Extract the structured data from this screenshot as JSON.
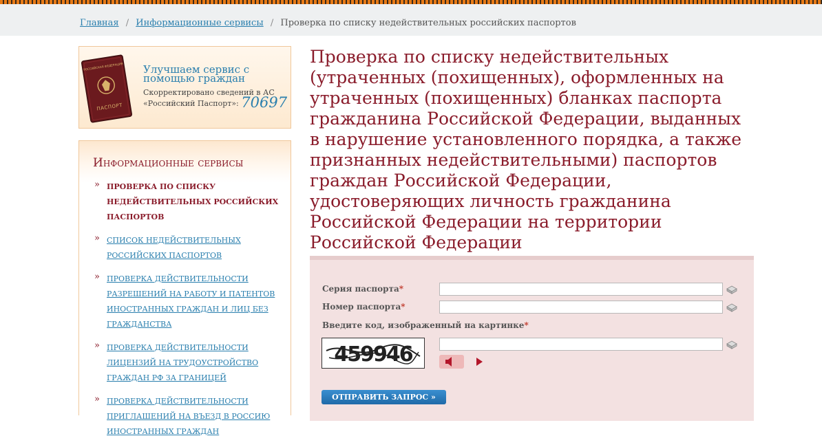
{
  "breadcrumb": {
    "home": "Главная",
    "services": "Информационные сервисы",
    "current": "Проверка по списку недействительных российских паспортов",
    "separator": "/"
  },
  "promo": {
    "passport_cover_top": "РОССИЙСКАЯ ФЕДЕРАЦИЯ",
    "passport_cover_bottom": "ПАСПОРТ",
    "title": "Улучшаем сервис с помощью граждан",
    "text": "Скорректировано сведений в АС «Российский Паспорт»:",
    "count": "70697"
  },
  "menu": {
    "title": "Информационные сервисы",
    "marker": "»",
    "items": [
      {
        "label": "Проверка по списку недействительных российских паспортов",
        "active": true
      },
      {
        "label": "Список недействительных российских паспортов",
        "active": false
      },
      {
        "label": "Проверка действительности разрешений на работу и патентов иностранных граждан и лиц без гражданства",
        "active": false
      },
      {
        "label": "Проверка действительности лицензий на трудоустройство граждан РФ за границей",
        "active": false
      },
      {
        "label": "Проверка действительности приглашений на въезд в Россию иностранных граждан",
        "active": false
      }
    ]
  },
  "main": {
    "title": "Проверка по списку недействительных (утраченных (похищенных), оформленных на утраченных (похищенных) бланках паспорта гражданина Российской Федерации, выданных в нарушение установленного порядка, а также признанных недействительными) паспортов граждан Российской Федерации, удостоверяющих личность гражданина Российской Федерации на территории Российской Федерации"
  },
  "form": {
    "series_label": "Серия паспорта",
    "number_label": "Номер паспорта",
    "captcha_label": "Введите код, изображенный на картинке",
    "required_mark": "*",
    "series_value": "",
    "number_value": "",
    "captcha_value": "",
    "captcha_text": "459946",
    "submit_label": "ОТПРАВИТЬ ЗАПРОС »"
  },
  "colors": {
    "link": "#2a7fae",
    "accent": "#8a1c2b",
    "form_bg": "#f3e1e1",
    "button": "#1f6aa8"
  },
  "icons": {
    "keyboard": "virtual-keyboard-icon",
    "audio": "speaker-icon",
    "play": "play-icon"
  }
}
